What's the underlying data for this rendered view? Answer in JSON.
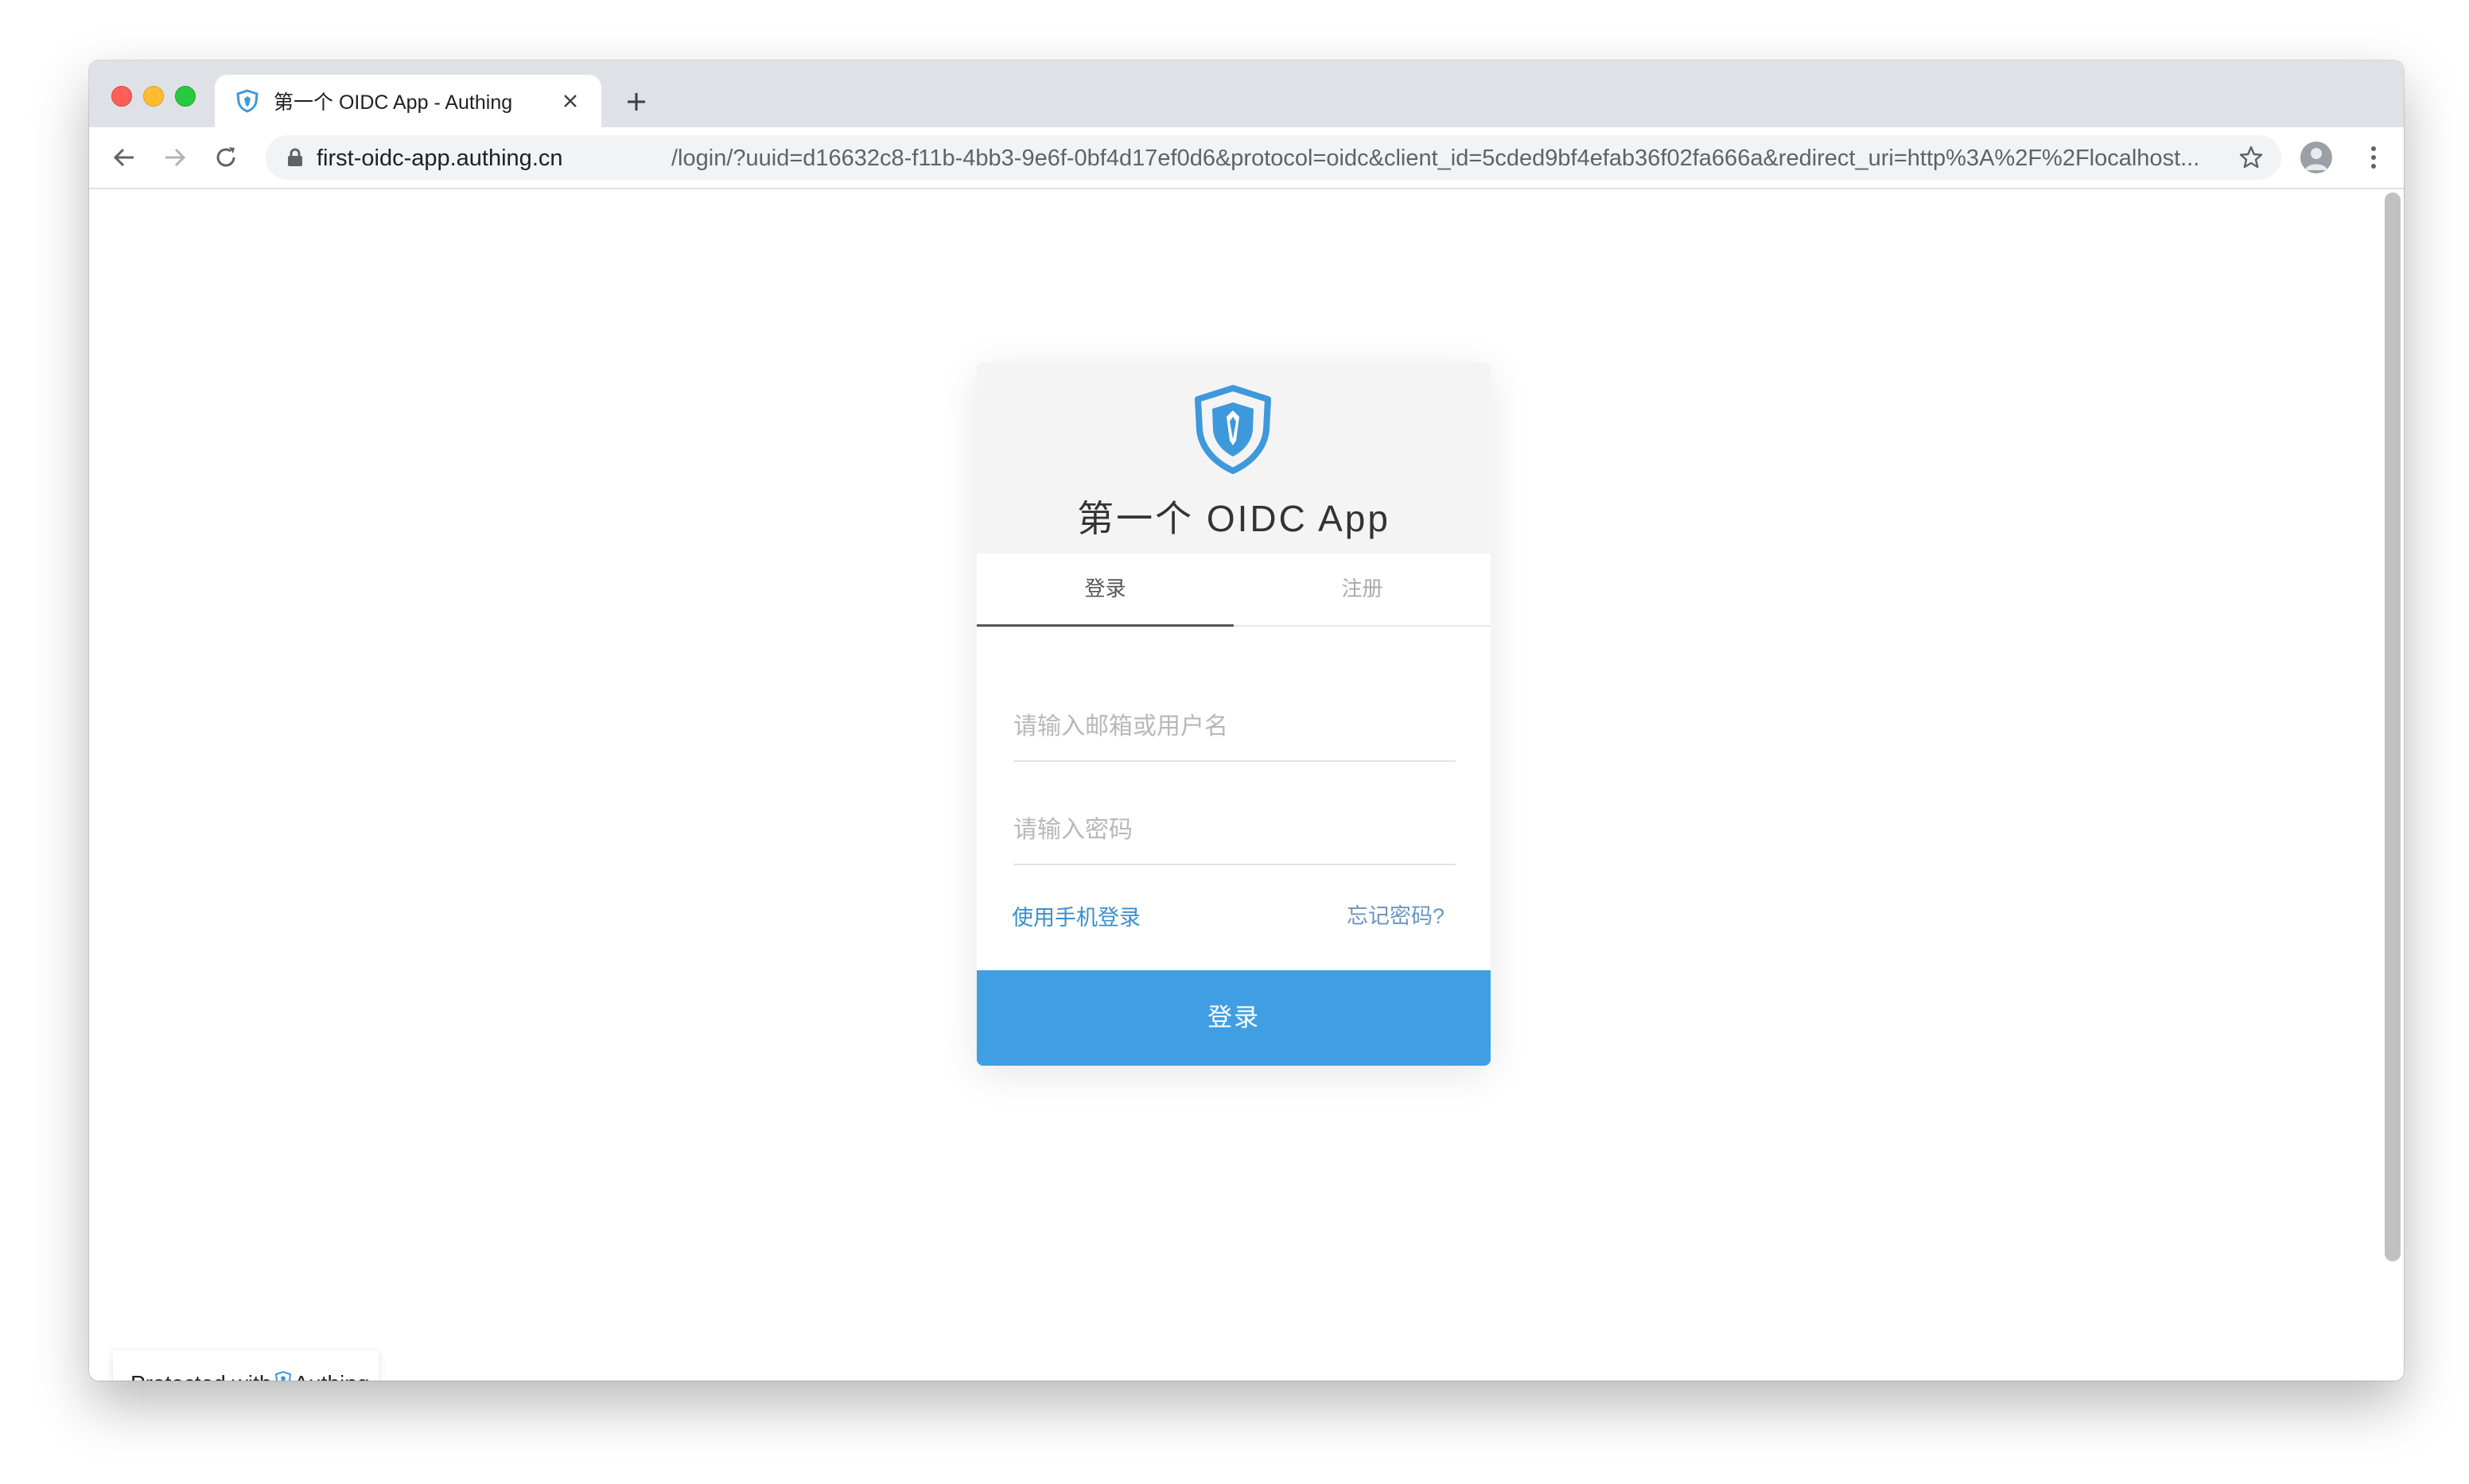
{
  "browser": {
    "tab_title": "第一个 OIDC App - Authing",
    "url_host": "first-oidc-app.authing.cn",
    "url_rest": "/login/?uuid=d16632c8-f11b-4bb3-9e6f-0bf4d17ef0d6&protocol=oidc&client_id=5cded9bf4efab36f02fa666a&redirect_uri=http%3A%2F%2Flocalhost...",
    "icons": [
      "shield-icon",
      "close-icon",
      "plus-icon",
      "back-icon",
      "forward-icon",
      "reload-icon",
      "lock-icon",
      "star-icon",
      "profile-icon",
      "more-icon"
    ]
  },
  "login_card": {
    "app_title": "第一个 OIDC App",
    "tabs": [
      {
        "label": "登录",
        "active": true
      },
      {
        "label": "注册",
        "active": false
      }
    ],
    "email_placeholder": "请输入邮箱或用户名",
    "password_placeholder": "请输入密码",
    "phone_login_link": "使用手机登录",
    "forgot_password_link": "忘记密码?",
    "submit_label": "登录"
  },
  "footer_badge": {
    "prefix": "Protected with",
    "brand": "Authing"
  },
  "colors": {
    "accent": "#409fe2",
    "link": "#3b8fcb",
    "brand_shield": "#3e98dc"
  }
}
